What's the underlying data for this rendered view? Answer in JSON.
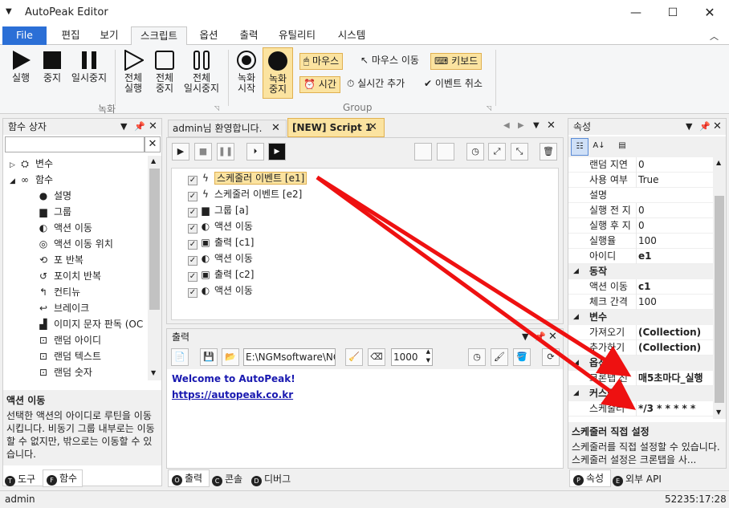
{
  "window": {
    "title": "AutoPeak Editor"
  },
  "ribbon_tabs": [
    "File",
    "편집",
    "보기",
    "스크립트",
    "옵션",
    "출력",
    "유틸리티",
    "시스템"
  ],
  "ribbon": {
    "record_group": {
      "run": "실행",
      "stop": "중지",
      "pause": "일시중지",
      "all_run": [
        "전체",
        "실행"
      ],
      "all_stop": [
        "전체",
        "중지"
      ],
      "all_pause": [
        "전체",
        "일시중지"
      ],
      "label": "녹화"
    },
    "group": {
      "rec_start": [
        "녹화",
        "시작"
      ],
      "rec_stop": [
        "녹화",
        "중지"
      ],
      "mouse": "마우스",
      "mouse_move": "마우스 이동",
      "keyboard": "키보드",
      "time": "시간",
      "realtime_add": "실시간 추가",
      "event_cancel": "이벤트 취소",
      "label": "Group"
    }
  },
  "toolbox": {
    "title": "함수 상자",
    "search_placeholder": "",
    "items": [
      {
        "label": "변수",
        "icon": "variable-icon",
        "level": 0,
        "expander": "▷"
      },
      {
        "label": "함수",
        "icon": "function-icon",
        "level": 0,
        "expander": "◢"
      },
      {
        "label": "설명",
        "icon": "comment-icon",
        "level": 1
      },
      {
        "label": "그룹",
        "icon": "group-icon",
        "level": 1
      },
      {
        "label": "액션 이동",
        "icon": "action-move-icon",
        "level": 1
      },
      {
        "label": "액션 이동 위치",
        "icon": "target-icon",
        "level": 1
      },
      {
        "label": "포 반복",
        "icon": "loop-icon",
        "level": 1
      },
      {
        "label": "포이치 반복",
        "icon": "foreach-icon",
        "level": 1
      },
      {
        "label": "컨티뉴",
        "icon": "continue-icon",
        "level": 1
      },
      {
        "label": "브레이크",
        "icon": "break-icon",
        "level": 1
      },
      {
        "label": "이미지 문자 판독 (OC",
        "icon": "ocr-icon",
        "level": 1
      },
      {
        "label": "랜덤 아이디",
        "icon": "random-id-icon",
        "level": 1
      },
      {
        "label": "랜덤 텍스트",
        "icon": "random-text-icon",
        "level": 1
      },
      {
        "label": "랜덤 숫자",
        "icon": "random-number-icon",
        "level": 1
      }
    ],
    "desc_title": "액션 이동",
    "desc_text": "선택한 액션의 아이디로 루틴을 이동시킵니다. 비동기 그룹 내부로는 이동할 수 없지만, 밖으로는 이동할 수 있습니다.",
    "tabs": [
      {
        "key": "T",
        "label": "도구"
      },
      {
        "key": "F",
        "label": "함수"
      }
    ]
  },
  "editor": {
    "tabs": [
      {
        "label": "admin님 환영합니다."
      },
      {
        "label": "[NEW] Script 1"
      }
    ],
    "items": [
      {
        "label": "스케줄러 이벤트 [e1]",
        "icon": "lightning-icon",
        "selected": true
      },
      {
        "label": "스케줄러 이벤트 [e2]",
        "icon": "lightning-icon"
      },
      {
        "label": "그룹 [a]",
        "icon": "group-icon"
      },
      {
        "label": "액션 이동",
        "icon": "action-move-icon"
      },
      {
        "label": "출력 [c1]",
        "icon": "console-icon"
      },
      {
        "label": "액션 이동",
        "icon": "action-move-icon"
      },
      {
        "label": "출력 [c2]",
        "icon": "console-icon"
      },
      {
        "label": "액션 이동",
        "icon": "action-move-icon"
      }
    ]
  },
  "output": {
    "title": "출력",
    "path": "E:\\NGMsoftware\\NG",
    "count": "1000",
    "lines": [
      "Welcome to AutoPeak!",
      "https://autopeak.co.kr"
    ],
    "tabs": [
      {
        "key": "O",
        "label": "출력"
      },
      {
        "key": "C",
        "label": "콘솔"
      },
      {
        "key": "D",
        "label": "디버그"
      }
    ]
  },
  "properties": {
    "title": "속성",
    "rows": [
      {
        "type": "row",
        "k": "랜덤 지연",
        "v": "0"
      },
      {
        "type": "row",
        "k": "사용 여부",
        "v": "True"
      },
      {
        "type": "row",
        "k": "설명",
        "v": ""
      },
      {
        "type": "row",
        "k": "실행 전 지",
        "v": "0"
      },
      {
        "type": "row",
        "k": "실행 후 지",
        "v": "0"
      },
      {
        "type": "row",
        "k": "실행율",
        "v": "100"
      },
      {
        "type": "row",
        "k": "아이디",
        "v": "e1",
        "bold": true
      },
      {
        "type": "cat",
        "k": "동작"
      },
      {
        "type": "row",
        "k": "액션 이동",
        "v": "c1",
        "bold": true
      },
      {
        "type": "row",
        "k": "체크 간격",
        "v": "100"
      },
      {
        "type": "cat",
        "k": "변수"
      },
      {
        "type": "row",
        "k": "가져오기",
        "v": "(Collection)",
        "bold": true
      },
      {
        "type": "row",
        "k": "추가하기",
        "v": "(Collection)",
        "bold": true
      },
      {
        "type": "cat",
        "k": "옵션"
      },
      {
        "type": "row",
        "k": "크론탭 선",
        "v": "매5초마다_실행",
        "bold": true
      },
      {
        "type": "cat",
        "k": "커스텀"
      },
      {
        "type": "row",
        "k": "스케줄러",
        "v": "*/3 * * * * *",
        "bold": true
      }
    ],
    "desc_title": "스케줄러 직접 설정",
    "desc_text": "스케줄러를 직접 설정할 수 있습니다. 스케줄러 설정은 크론탭을 사...",
    "tabs": [
      {
        "key": "P",
        "label": "속성"
      },
      {
        "key": "E",
        "label": "외부 API"
      }
    ]
  },
  "status": {
    "user": "admin",
    "time": "52235:17:28"
  },
  "colors": {
    "accent": "#2b6fd6",
    "highlight": "#fbe3a0",
    "arrow": "#ee1111",
    "link": "#0000cc"
  }
}
